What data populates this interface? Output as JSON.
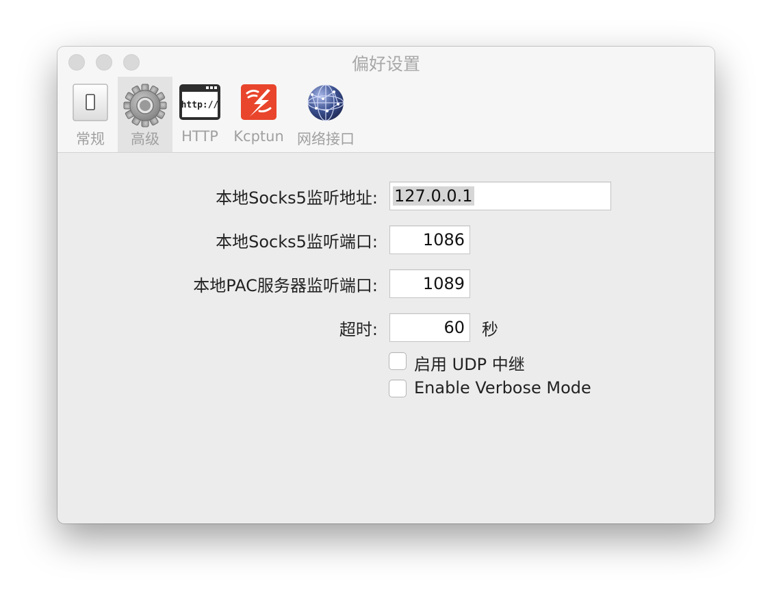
{
  "window": {
    "title": "偏好设置"
  },
  "tabs": [
    {
      "label": "常规",
      "icon": "switch-icon"
    },
    {
      "label": "高级",
      "icon": "gear-icon",
      "selected": true
    },
    {
      "label": "HTTP",
      "icon": "http-browser-icon"
    },
    {
      "label": "Kcptun",
      "icon": "kcptun-icon"
    },
    {
      "label": "网络接口",
      "icon": "network-globe-icon"
    }
  ],
  "form": {
    "socks5_address_label": "本地Socks5监听地址:",
    "socks5_address_value": "127.0.0.1",
    "socks5_port_label": "本地Socks5监听端口:",
    "socks5_port_value": "1086",
    "pac_port_label": "本地PAC服务器监听端口:",
    "pac_port_value": "1089",
    "timeout_label": "超时:",
    "timeout_value": "60",
    "timeout_unit": "秒",
    "udp_relay_label": "启用 UDP 中继",
    "udp_relay_checked": false,
    "verbose_label": "Enable Verbose Mode",
    "verbose_checked": false
  },
  "colors": {
    "kcptun_brand": "#e8452c",
    "globe_blue": "#3a4f8e"
  }
}
